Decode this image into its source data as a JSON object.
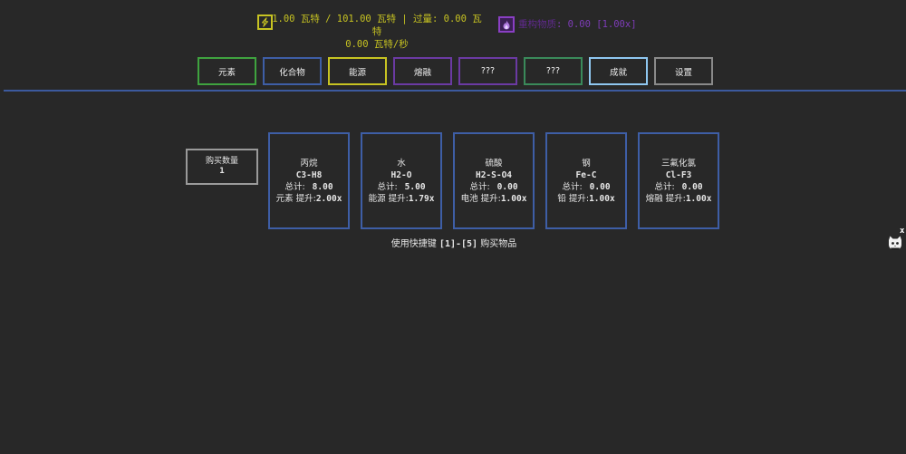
{
  "header": {
    "energy_icon": "lightning-icon",
    "energy_color": "#c7c322",
    "energy_line1": "1.00 瓦特 / 101.00 瓦特 | 过量: 0.00 瓦特",
    "energy_line2": "0.00 瓦特/秒",
    "matter_icon": "flame-icon",
    "matter_color": "#7e3cb8",
    "matter_label": "重构物质",
    "matter_value": "0.00 [1.00x]"
  },
  "tabs": [
    {
      "label": "元素",
      "color": "#3fa33f"
    },
    {
      "label": "化合物",
      "color": "#3e5ea6"
    },
    {
      "label": "能源",
      "color": "#c7c322"
    },
    {
      "label": "熔融",
      "color": "#6b3aa3"
    },
    {
      "label": "???",
      "color": "#6b3aa3"
    },
    {
      "label": "???",
      "color": "#3a8a5a"
    },
    {
      "label": "成就",
      "color": "#8fc7f0"
    },
    {
      "label": "设置",
      "color": "#8a8a8a"
    }
  ],
  "buy": {
    "label": "购买数量",
    "value": "1"
  },
  "items": [
    {
      "name": "丙烷",
      "formula": "C3-H8",
      "total_label": "总计:",
      "total": "8.00",
      "boost_source": "元素",
      "boost_label": "提升:",
      "boost": "2.00x"
    },
    {
      "name": "水",
      "formula": "H2-O",
      "total_label": "总计:",
      "total": "5.00",
      "boost_source": "能源",
      "boost_label": "提升:",
      "boost": "1.79x"
    },
    {
      "name": "硫酸",
      "formula": "H2-S-O4",
      "total_label": "总计:",
      "total": "0.00",
      "boost_source": "电池",
      "boost_label": "提升:",
      "boost": "1.00x"
    },
    {
      "name": "钢",
      "formula": "Fe-C",
      "total_label": "总计:",
      "total": "0.00",
      "boost_source": "铅",
      "boost_label": "提升:",
      "boost": "1.00x"
    },
    {
      "name": "三氟化氯",
      "formula": "Cl-F3",
      "total_label": "总计:",
      "total": "0.00",
      "boost_source": "熔融",
      "boost_label": "提升:",
      "boost": "1.00x"
    }
  ],
  "hint": {
    "prefix": "使用快捷键 ",
    "keys": "[1]-[5]",
    "suffix": " 购买物品"
  },
  "side": {
    "close_label": "x",
    "avatar_icon": "cat-avatar-icon"
  }
}
